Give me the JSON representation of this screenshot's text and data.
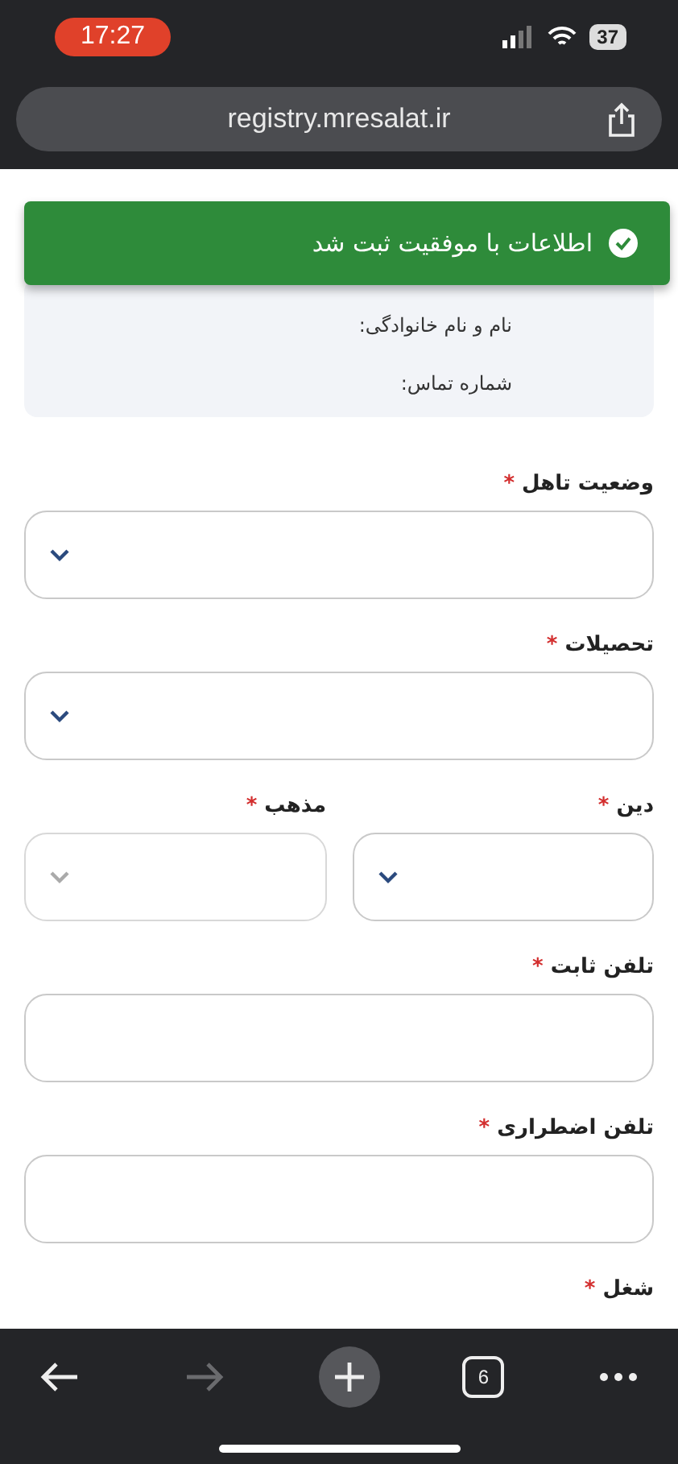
{
  "status_bar": {
    "time": "17:27",
    "battery": "37"
  },
  "address_bar": {
    "url": "registry.mresalat.ir"
  },
  "toast": {
    "message": "اطلاعات با موفقیت ثبت شد"
  },
  "info_card": {
    "lines": [
      "نام و نام خانوادگی:",
      "شماره تماس:"
    ]
  },
  "form": {
    "rows": [
      {
        "fields": [
          {
            "label": "وضعیت تاهل",
            "marker": "*",
            "kind": "select",
            "disabled": false
          }
        ]
      },
      {
        "fields": [
          {
            "label": "تحصیلات",
            "marker": "*",
            "kind": "select",
            "disabled": false
          }
        ]
      },
      {
        "fields": [
          {
            "label": "دین",
            "marker": "*",
            "kind": "select",
            "disabled": false
          },
          {
            "label": "مذهب",
            "marker": "*",
            "kind": "select",
            "disabled": true
          }
        ]
      },
      {
        "fields": [
          {
            "label": "تلفن ثابت",
            "marker": "*",
            "kind": "text"
          }
        ]
      },
      {
        "fields": [
          {
            "label": "تلفن اضطراری",
            "marker": "*",
            "kind": "text"
          }
        ]
      },
      {
        "fields": [
          {
            "label": "شغل",
            "marker": "*",
            "kind": "label"
          }
        ]
      }
    ]
  },
  "toolbar": {
    "tab_count": "6",
    "forward_disabled": true
  }
}
